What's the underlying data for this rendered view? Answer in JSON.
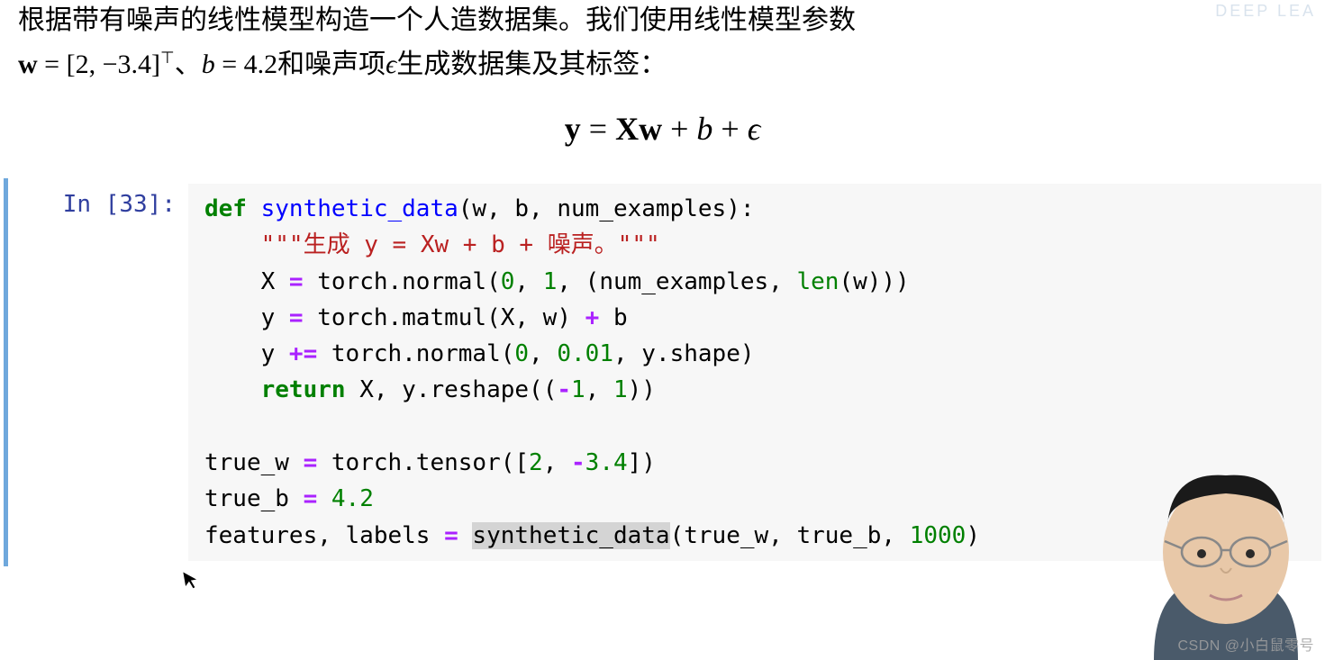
{
  "prose": {
    "line1": "根据带有噪声的线性模型构造一个人造数据集。我们使用线性模型参数",
    "w_lhs": "w",
    "w_eq": " = [2, −3.4]",
    "w_sup": "⊤",
    "sep": "、",
    "b_lhs": "b",
    "b_eq": " = 4.2",
    "tail": "和噪声项",
    "eps": "ϵ",
    "tail2": "生成数据集及其标签："
  },
  "equation": {
    "y": "y",
    "eq": " = ",
    "X": "X",
    "w": "w",
    "plus1": " + ",
    "b": "b",
    "plus2": " + ",
    "eps": "ϵ"
  },
  "cell": {
    "prompt": "In [33]:",
    "code": {
      "l1_def": "def",
      "l1_name": " synthetic_data",
      "l1_rest": "(w, b, num_examples):",
      "l2_doc": "    \"\"\"生成 y = Xw + b + 噪声。\"\"\"",
      "l3_a": "    X ",
      "l3_op": "=",
      "l3_b": " torch.normal(",
      "l3_n0": "0",
      "l3_c": ", ",
      "l3_n1": "1",
      "l3_d": ", (num_examples, ",
      "l3_len": "len",
      "l3_e": "(w)))",
      "l4_a": "    y ",
      "l4_op": "=",
      "l4_b": " torch.matmul(X, w) ",
      "l4_op2": "+",
      "l4_c": " b",
      "l5_a": "    y ",
      "l5_op": "+=",
      "l5_b": " torch.normal(",
      "l5_n0": "0",
      "l5_c": ", ",
      "l5_n1": "0.01",
      "l5_d": ", y.shape)",
      "l6_ret": "    return",
      "l6_a": " X, y.reshape((",
      "l6_op": "-",
      "l6_n1": "1",
      "l6_b": ", ",
      "l6_n2": "1",
      "l6_c": "))",
      "blank": "",
      "l8_a": "true_w ",
      "l8_op": "=",
      "l8_b": " torch.tensor([",
      "l8_n0": "2",
      "l8_c": ", ",
      "l8_op2": "-",
      "l8_n1": "3.4",
      "l8_d": "])",
      "l9_a": "true_b ",
      "l9_op": "=",
      "l9_b": " ",
      "l9_n": "4.2",
      "l10_a": "features, labels ",
      "l10_op": "=",
      "l10_b": " ",
      "l10_hl": "synthetic_data",
      "l10_c": "(true_w, true_b, ",
      "l10_n": "1000",
      "l10_d": ")"
    }
  },
  "watermark": "CSDN @小白鼠零号",
  "wm_top": "DEEP LEA"
}
